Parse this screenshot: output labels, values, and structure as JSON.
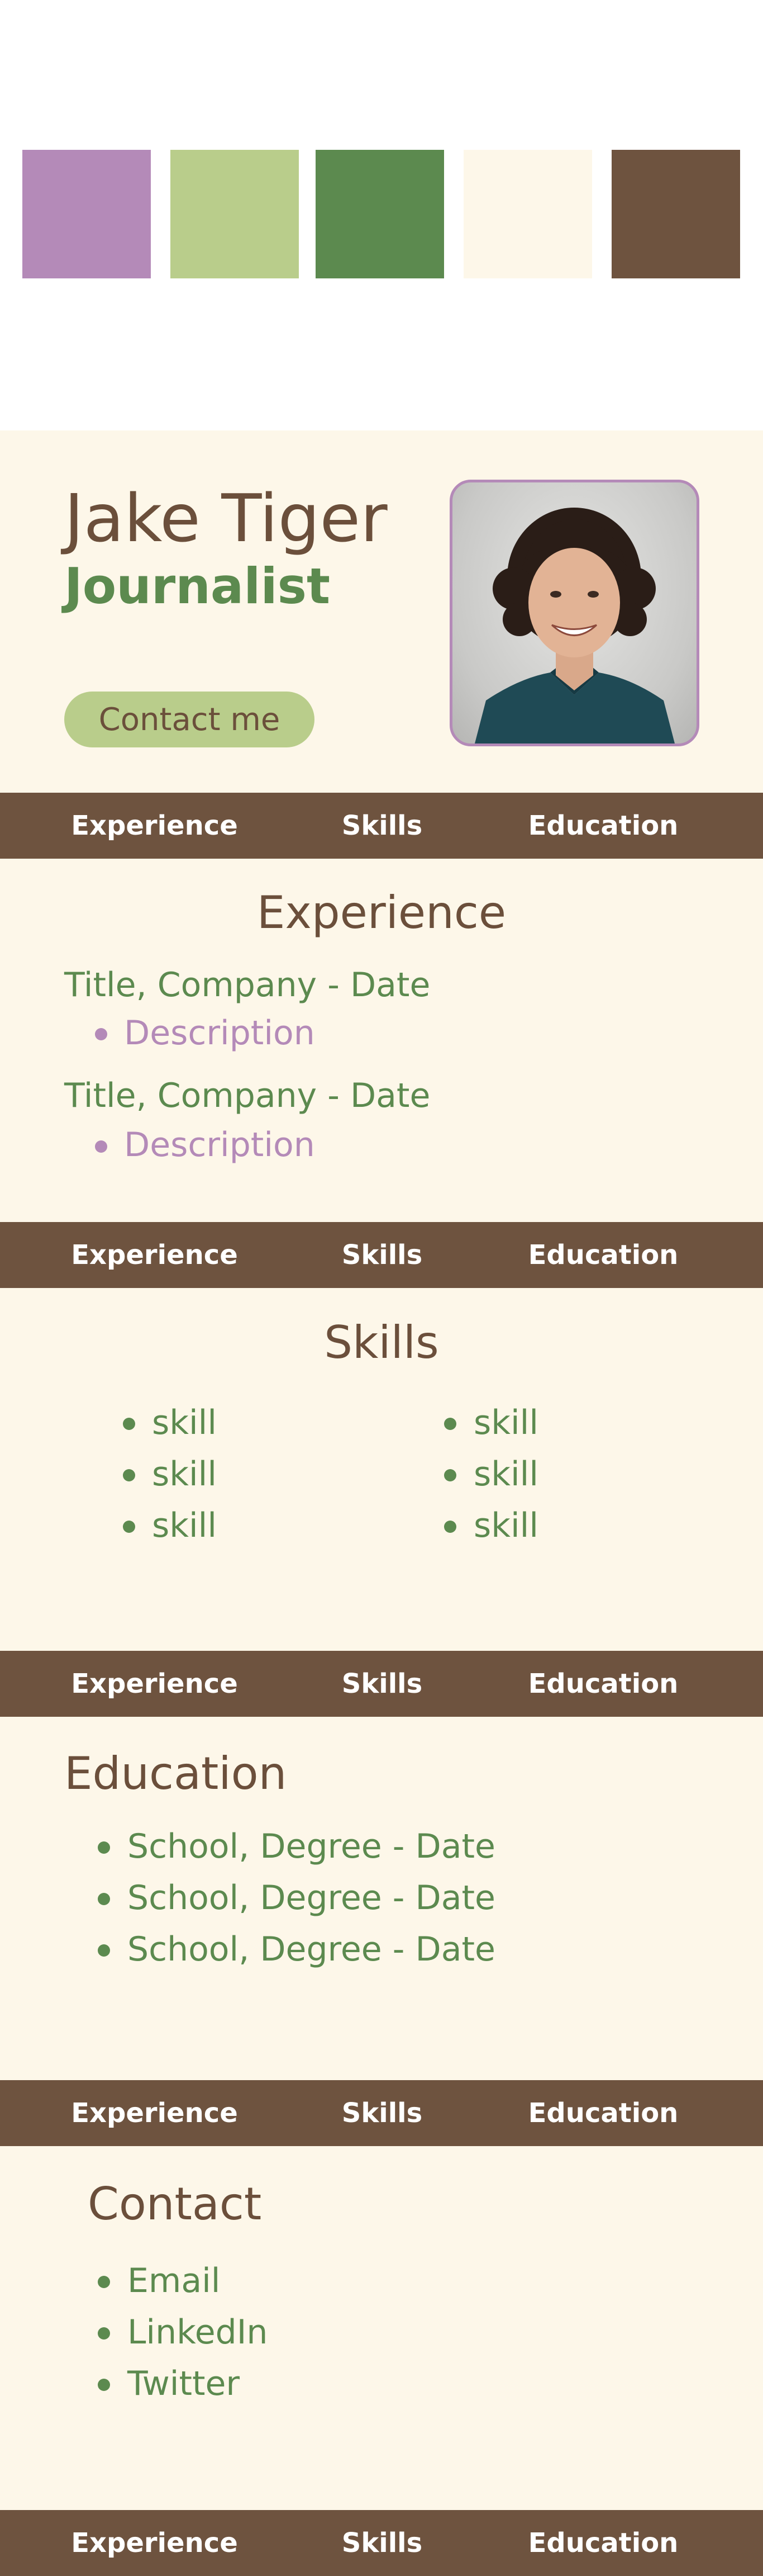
{
  "palette": [
    "#b48ab8",
    "#b9cd8b",
    "#5c8a4f",
    "#fdf7e9",
    "#6e533f"
  ],
  "profile": {
    "name": "Jake Tiger",
    "role": "Journalist",
    "contact_button": "Contact me",
    "photo_icon": "portrait-photo"
  },
  "nav": {
    "experience": "Experience",
    "skills": "Skills",
    "education": "Education"
  },
  "experience": {
    "title": "Experience",
    "items": [
      {
        "heading": "Title, Company - Date",
        "description": "Description"
      },
      {
        "heading": "Title, Company - Date",
        "description": "Description"
      }
    ]
  },
  "skills": {
    "title": "Skills",
    "left": [
      "skill",
      "skill",
      "skill"
    ],
    "right": [
      "skill",
      "skill",
      "skill"
    ]
  },
  "education": {
    "title": "Education",
    "items": [
      "School, Degree - Date",
      "School, Degree - Date",
      "School, Degree - Date"
    ]
  },
  "contact": {
    "title": "Contact",
    "items": [
      "Email",
      "LinkedIn",
      "Twitter"
    ]
  }
}
